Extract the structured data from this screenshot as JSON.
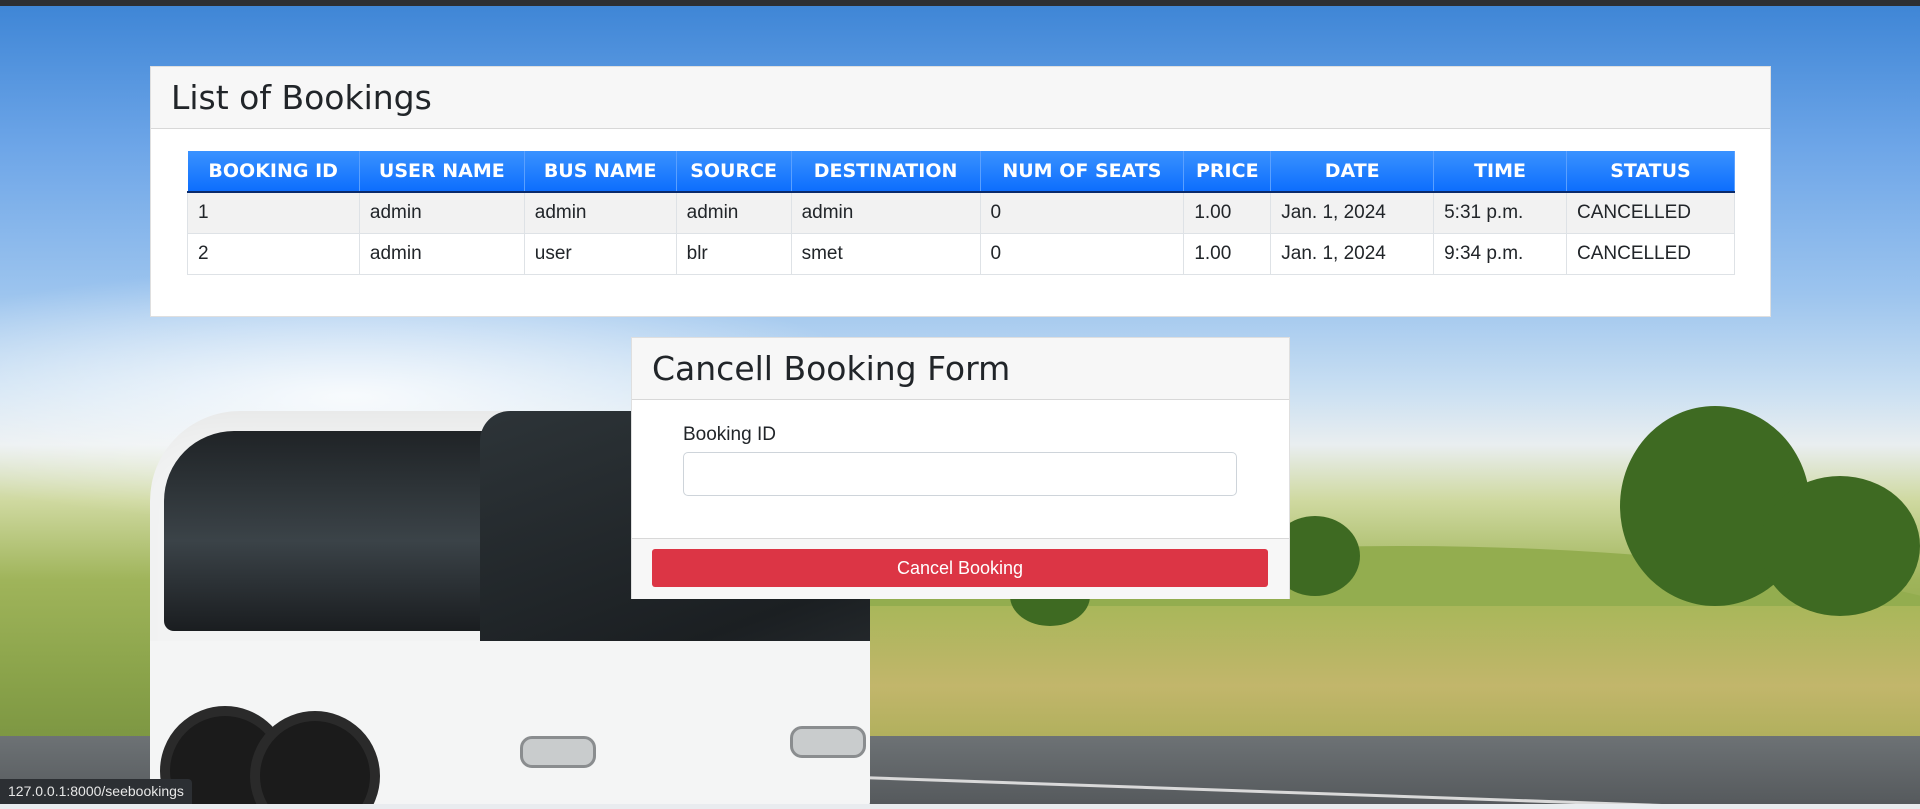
{
  "bookings": {
    "title": "List of Bookings",
    "columns": [
      "BOOKING ID",
      "USER NAME",
      "BUS NAME",
      "SOURCE",
      "DESTINATION",
      "NUM OF SEATS",
      "PRICE",
      "DATE",
      "TIME",
      "STATUS"
    ],
    "rows": [
      [
        "1",
        "admin",
        "admin",
        "admin",
        "admin",
        "0",
        "1.00",
        "Jan. 1, 2024",
        "5:31 p.m.",
        "CANCELLED"
      ],
      [
        "2",
        "admin",
        "user",
        "blr",
        "smet",
        "0",
        "1.00",
        "Jan. 1, 2024",
        "9:34 p.m.",
        "CANCELLED"
      ]
    ]
  },
  "cancel_form": {
    "title": "Cancell Booking Form",
    "booking_id_label": "Booking ID",
    "booking_id_value": "",
    "booking_id_placeholder": "",
    "submit_label": "Cancel Booking"
  },
  "status_bar": {
    "url": "127.0.0.1:8000/seebookings"
  },
  "colors": {
    "table_header": "#0d6efd",
    "danger_button": "#dc3545"
  }
}
